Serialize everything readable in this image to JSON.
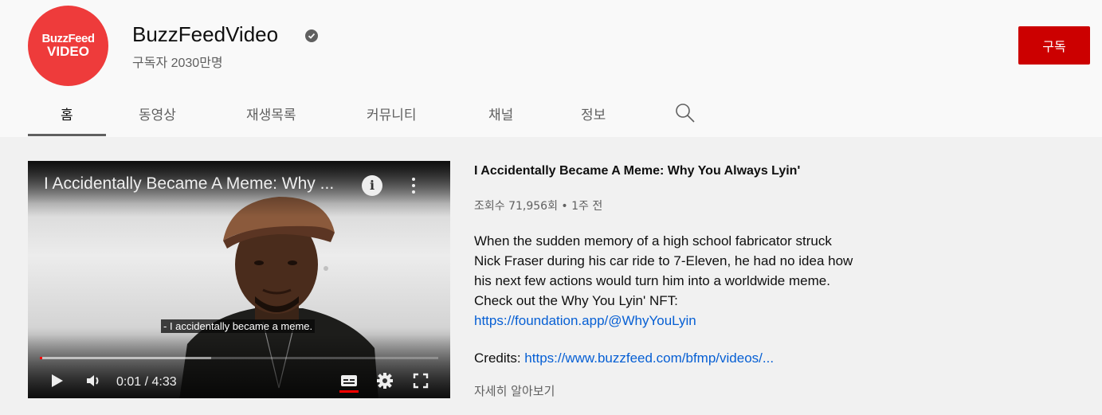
{
  "channel": {
    "avatar_line1": "BuzzFeed",
    "avatar_line2": "VIDEO",
    "name": "BuzzFeedVideo",
    "subscribers": "구독자 2030만명",
    "subscribe_label": "구독"
  },
  "tabs": [
    {
      "label": "홈",
      "active": true
    },
    {
      "label": "동영상"
    },
    {
      "label": "재생목록"
    },
    {
      "label": "커뮤니티"
    },
    {
      "label": "채널"
    },
    {
      "label": "정보"
    }
  ],
  "player": {
    "title": "I Accidentally Became A Meme: Why ...",
    "caption": "- I accidentally became a meme.",
    "time": "0:01 / 4:33",
    "progress_played": 0.004,
    "progress_buffered": 0.43
  },
  "video": {
    "title": "I Accidentally Became A Meme: Why You Always Lyin'",
    "views": "조회수 71,956회 • 1주 전",
    "description_lines": [
      "When the sudden memory of a high school fabricator struck",
      "Nick Fraser during his car ride to 7-Eleven, he had no idea how",
      "his next few actions would turn him into a worldwide meme.",
      "Check out the Why You Lyin' NFT:"
    ],
    "nft_link": "https://foundation.app/@WhyYouLyin",
    "credits_label": "Credits: ",
    "credits_link": "https://www.buzzfeed.com/bfmp/videos/...",
    "more_label": "자세히 알아보기"
  },
  "colors": {
    "accent_red": "#cc0000",
    "link": "#065fd4",
    "avatar_red": "#ee3b3b"
  }
}
